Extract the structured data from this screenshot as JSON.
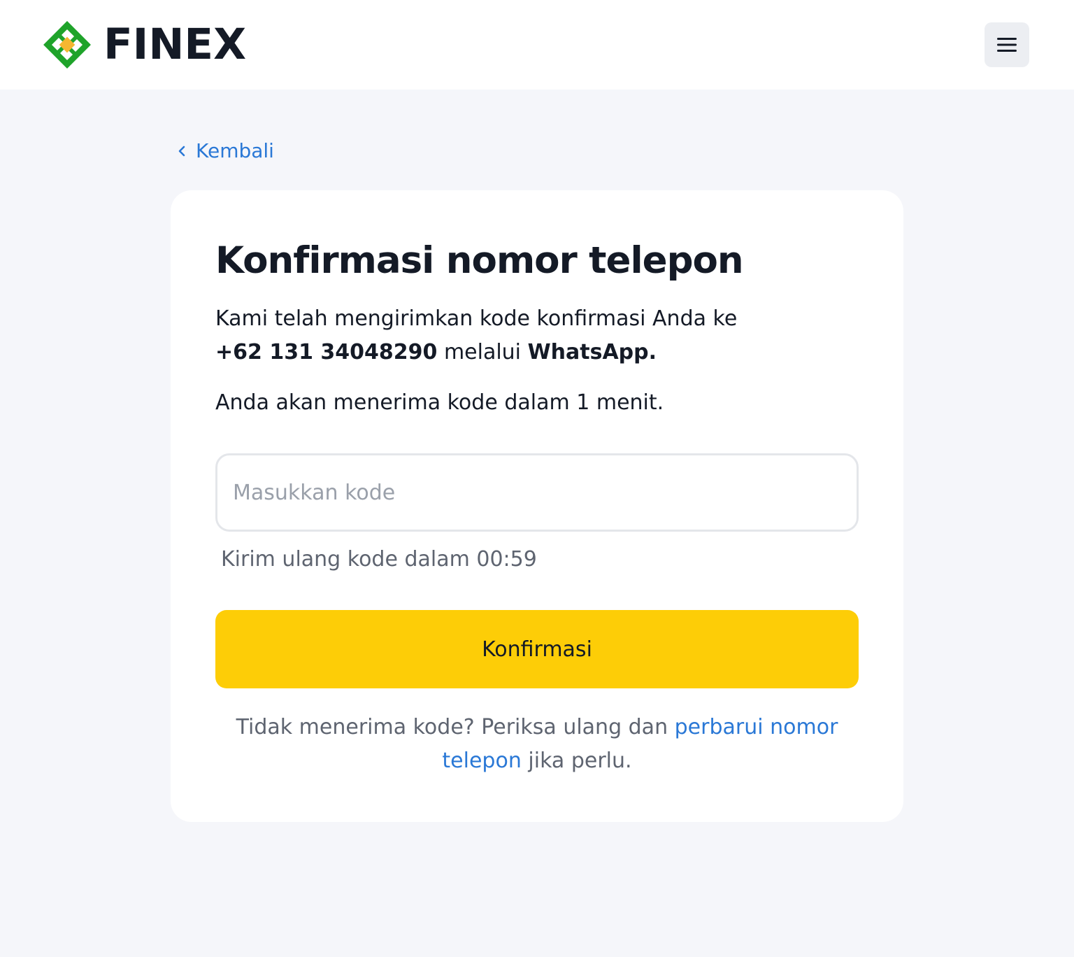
{
  "header": {
    "brand": "FINEX",
    "logo_icon": "finex-logo-icon",
    "menu_icon": "hamburger-menu-icon"
  },
  "nav": {
    "back_label": "Kembali",
    "back_icon": "chevron-left-icon"
  },
  "card": {
    "title": "Konfirmasi nomor telepon",
    "desc_prefix": "Kami telah mengirimkan kode konfirmasi Anda ke",
    "phone": "+62 131 34048290",
    "desc_via": "melalui",
    "channel": "WhatsApp.",
    "eta": "Anda akan menerima kode dalam 1 menit.",
    "code_placeholder": "Masukkan kode",
    "code_value": "",
    "resend_text": "Kirim ulang kode dalam 00:59",
    "confirm_label": "Konfirmasi",
    "help_prefix": "Tidak menerima kode? Periksa ulang dan",
    "help_link": "perbarui nomor telepon",
    "help_suffix": "jika perlu."
  },
  "colors": {
    "page_bg": "#f5f6fa",
    "brand_green": "#1fa32a",
    "brand_yellow": "#f5b731",
    "accent_button": "#fdcd07",
    "link": "#2a78d6",
    "text_dark": "#141a26",
    "text_muted": "#5e6470"
  }
}
